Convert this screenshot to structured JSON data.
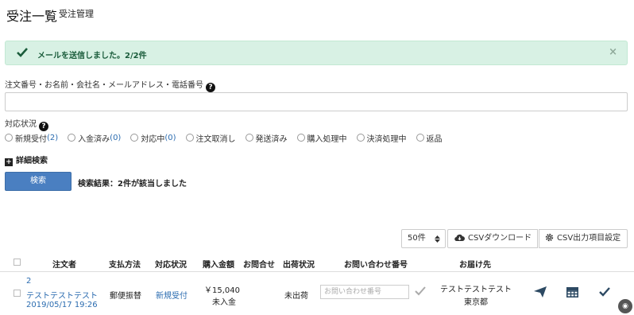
{
  "header": {
    "title": "受注一覧",
    "subtitle": "受注管理"
  },
  "alert": {
    "message": "メールを送信しました。2/2件",
    "close": "×"
  },
  "search": {
    "keyword_label": "注文番号・お名前・会社名・メールアドレス・電話番号",
    "keyword_value": "",
    "status_label": "対応状況",
    "statuses": [
      {
        "label": "新規受付",
        "count": "(2)"
      },
      {
        "label": "入金済み",
        "count": "(0)"
      },
      {
        "label": "対応中",
        "count": "(0)"
      },
      {
        "label": "注文取消し",
        "count": ""
      },
      {
        "label": "発送済み",
        "count": ""
      },
      {
        "label": "購入処理中",
        "count": ""
      },
      {
        "label": "決済処理中",
        "count": ""
      },
      {
        "label": "返品",
        "count": ""
      }
    ],
    "detail_label": "詳細検索",
    "button_label": "検索",
    "result_text": "検索結果：2件が該当しました"
  },
  "toolbar": {
    "per_page": "50件",
    "csv_download": "CSVダウンロード",
    "csv_settings": "CSV出力項目設定"
  },
  "table": {
    "headers": [
      "注文者",
      "支払方法",
      "対応状況",
      "購入金額",
      "お問合せ",
      "出荷状況",
      "お問い合わせ番号",
      "お届け先"
    ],
    "rows": [
      {
        "order_id": "2",
        "customer": "テストテストテスト",
        "date": "2019/05/17 19:26",
        "payment": "郵便振替",
        "status": "新規受付",
        "amount": "￥15,040",
        "paid": "未入金",
        "shipping": "未出荷",
        "inquiry_placeholder": "お問い合わせ番号",
        "dest_name": "テストテストテスト",
        "dest_pref": "東京都"
      }
    ]
  },
  "colors": {
    "accent": "#4a7fc1",
    "alert_bg": "#d8f1e4",
    "link": "#2b6cb0"
  }
}
